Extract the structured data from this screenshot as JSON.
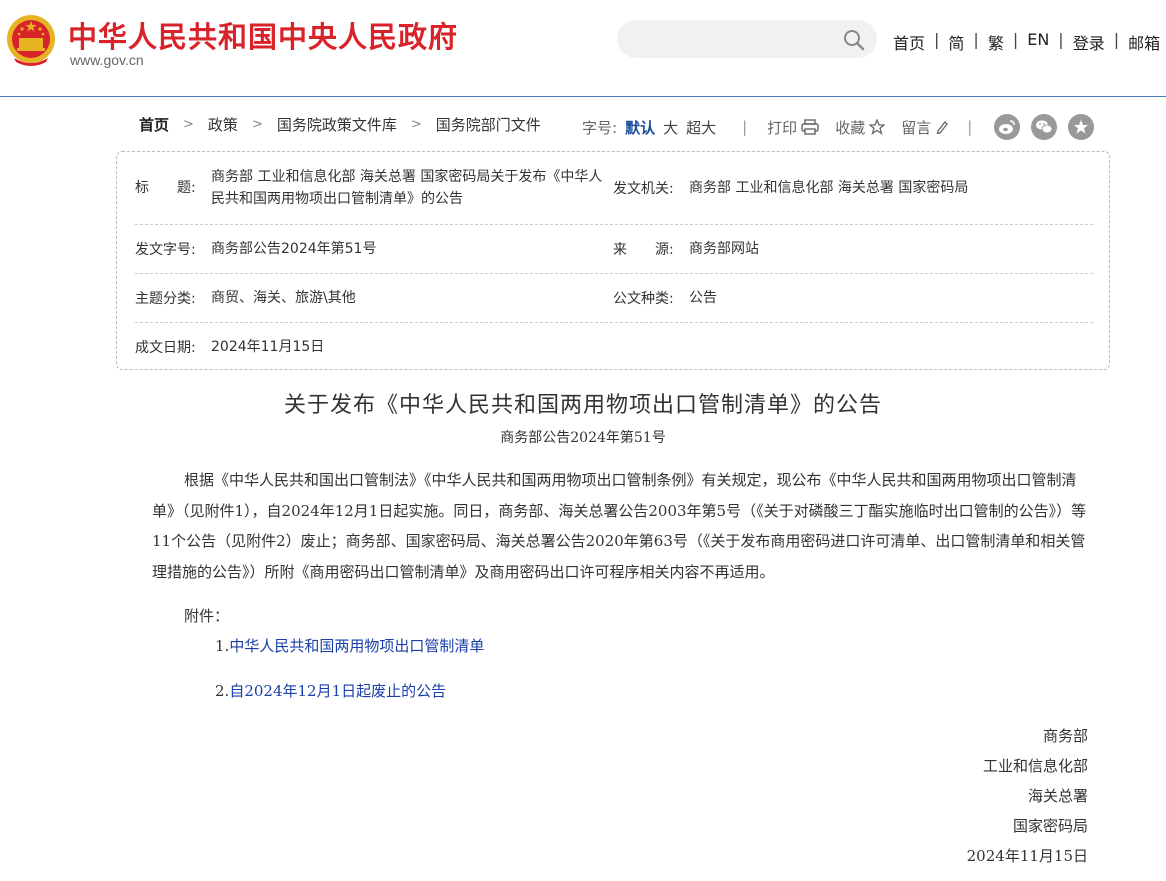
{
  "header": {
    "site_title": "中华人民共和国中央人民政府",
    "site_url": "www.gov.cn",
    "search": {
      "placeholder": ""
    },
    "nav": [
      "首页",
      "简",
      "繁",
      "EN",
      "登录",
      "邮箱"
    ],
    "nav_separator": "|",
    "emblem_colors": {
      "red": "#d8232a",
      "gold": "#e6b422"
    }
  },
  "breadcrumb": {
    "items": [
      "首页",
      "政策",
      "国务院政策文件库",
      "国务院部门文件"
    ],
    "separator": ">"
  },
  "tools": {
    "font_label": "字号:",
    "sizes": [
      "默认",
      "大",
      "超大"
    ],
    "active_size": "默认",
    "divider": "|",
    "print": "打印",
    "favorite": "收藏",
    "comment": "留言",
    "social_icons": [
      "weibo-icon",
      "wechat-icon",
      "star-share-icon"
    ]
  },
  "info": {
    "title_label": "标　　题:",
    "title_value": "商务部 工业和信息化部 海关总署 国家密码局关于发布《中华人民共和国两用物项出口管制清单》的公告",
    "issuer_label": "发文机关:",
    "issuer_value": "商务部 工业和信息化部 海关总署 国家密码局",
    "docno_label": "发文字号:",
    "docno_value": "商务部公告2024年第51号",
    "source_label": "来　　源:",
    "source_value": "商务部网站",
    "topic_label": "主题分类:",
    "topic_value": "商贸、海关、旅游\\其他",
    "type_label": "公文种类:",
    "type_value": "公告",
    "date_label": "成文日期:",
    "date_value": "2024年11月15日"
  },
  "article": {
    "title": "关于发布《中华人民共和国两用物项出口管制清单》的公告",
    "doc_number": "商务部公告2024年第51号",
    "body": "根据《中华人民共和国出口管制法》《中华人民共和国两用物项出口管制条例》有关规定，现公布《中华人民共和国两用物项出口管制清单》（见附件1），自2024年12月1日起实施。同日，商务部、海关总署公告2003年第5号（《关于对磷酸三丁酯实施临时出口管制的公告》）等11个公告（见附件2）废止；商务部、国家密码局、海关总署公告2020年第63号（《关于发布商用密码进口许可清单、出口管制清单和相关管理措施的公告》）所附《商用密码出口管制清单》及商用密码出口许可程序相关内容不再适用。",
    "attachments_label": "附件：",
    "attachments": [
      {
        "num": "1.",
        "title": "中华人民共和国两用物项出口管制清单"
      },
      {
        "num": "2.",
        "title": "自2024年12月1日起废止的公告"
      }
    ],
    "signatories": [
      "商务部",
      "工业和信息化部",
      "海关总署",
      "国家密码局"
    ],
    "sign_date": "2024年11月15日",
    "link_color": "#1a3fa8"
  }
}
